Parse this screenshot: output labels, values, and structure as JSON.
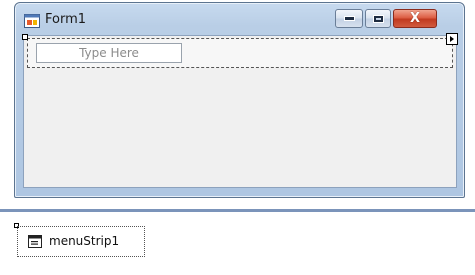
{
  "form": {
    "title": "Form1",
    "icon": "form-icon",
    "caption_buttons": {
      "minimize": "minimize-icon",
      "maximize": "maximize-icon",
      "close": "close-icon",
      "close_glyph": "X"
    },
    "menu_strip": {
      "placeholder": "Type Here"
    }
  },
  "tray": {
    "components": [
      {
        "label": "menuStrip1",
        "icon": "menustrip-icon"
      }
    ]
  },
  "colors": {
    "title_bar": "#b9cee6",
    "close_button": "#c13a20",
    "client_area": "#f0f0f0",
    "tray_divider": "#7b94ba"
  }
}
